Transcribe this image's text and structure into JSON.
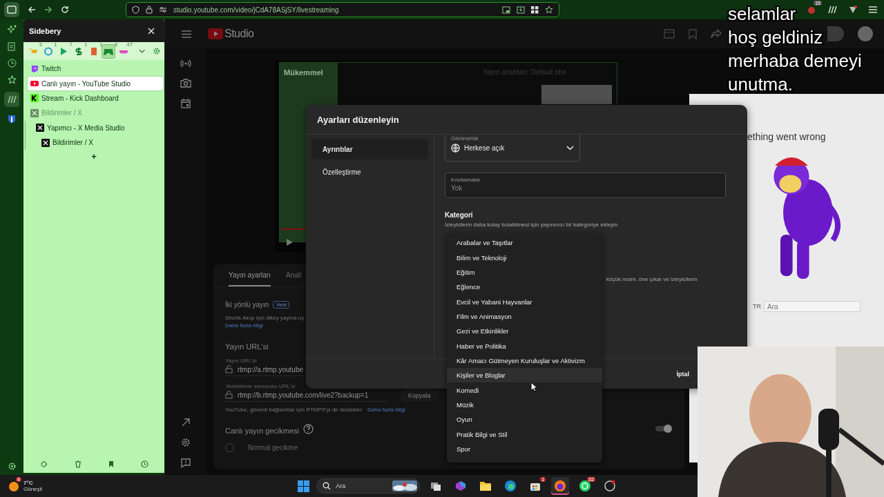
{
  "browser": {
    "url": "studio.youtube.com/video/jCdA78ASjSY/livestreaming",
    "extension_badge": "15"
  },
  "sidebery": {
    "title": "Sidebery",
    "panels": [
      {
        "kind": "cart",
        "count": "3",
        "color": "#e8b020",
        "selected": false
      },
      {
        "kind": "circle",
        "count": "1",
        "color": "#2a9ad8",
        "selected": false
      },
      {
        "kind": "play",
        "count": "7",
        "color": "#18a860",
        "selected": false
      },
      {
        "kind": "dollar",
        "count": "1",
        "color": "#1a7a30",
        "selected": false
      },
      {
        "kind": "book",
        "count": "1",
        "color": "#e06030",
        "selected": false
      },
      {
        "kind": "gamepad",
        "count": "6",
        "color": "#1a8a30",
        "selected": true
      },
      {
        "kind": "glasses",
        "count": "47",
        "color": "#e040c0",
        "selected": false
      }
    ],
    "tabs": [
      {
        "title": "Twitch",
        "kind": "twitch",
        "selected": false,
        "discarded": false
      },
      {
        "title": "Canlı yayın - YouTube Studio",
        "kind": "youtube",
        "selected": true,
        "discarded": false
      },
      {
        "title": "Stream - Kick Dashboard",
        "kind": "kick",
        "selected": false,
        "discarded": false
      },
      {
        "title": "Bildirimler / X",
        "kind": "x",
        "selected": false,
        "discarded": true,
        "children": [
          {
            "title": "Yapımcı - X Media Studio",
            "kind": "x",
            "selected": false,
            "discarded": false,
            "children": [
              {
                "title": "Bildirimler / X",
                "kind": "x",
                "selected": false,
                "discarded": false
              }
            ]
          }
        ]
      }
    ],
    "new_tab": "+"
  },
  "studio": {
    "logo_text": "Studio"
  },
  "preview": {
    "title": "Mükemmel",
    "stream_key": "Yayın anahtarı: Default stre"
  },
  "stream_settings": {
    "tabs": [
      {
        "label": "Yayın ayarları",
        "selected": true
      },
      {
        "label": "Anali",
        "selected": false
      }
    ],
    "two_way": "İki yönlü yayın",
    "badge": "Yeni",
    "two_way_text": "Shorts Akışı için dikey yayına uy",
    "more": "Daha fazla bilgi",
    "url_heading": "Yayın URL'si",
    "url_label": "Yayın URL'si",
    "url_value": "rtmp://a.rtmp.youtube",
    "backup_label": "Yedekleme sunucusu URL'si",
    "backup_value": "rtmp://b.rtmp.youtube.com/live2?backup=1",
    "copy": "Kopyala",
    "rtmps_note": "YouTube, güvenli bağlantılar için RTMPS'yi de destekler.",
    "rtmps_more": "Daha fazla bilgi",
    "latency_heading": "Canlı yayın gecikmesi",
    "latency_toggle_on": true,
    "latency_option": "Normal gecikme"
  },
  "dialog": {
    "title": "Ayarları düzenleyin",
    "nav": [
      {
        "label": "Ayrıntılar",
        "selected": true
      },
      {
        "label": "Özelleştirme",
        "selected": false
      }
    ],
    "visibility": {
      "label": "Görünürlük",
      "value": "Herkese açık"
    },
    "restrictions": {
      "label": "Kısıtlamalar",
      "value": "Yok"
    },
    "category": {
      "heading": "Kategori",
      "hint": "İzleyicilerin daha kolay bulabilmesi için yayınınızı bir kategoriye ekleyin"
    },
    "thumbnail_hint": "küçük resim, öne çıkar ve izleyicilerin",
    "cancel": "İptal",
    "menu": [
      {
        "label": "Arabalar ve Taşıtlar",
        "selected": false
      },
      {
        "label": "Bilim ve Teknoloji",
        "selected": false
      },
      {
        "label": "Eğitim",
        "selected": false
      },
      {
        "label": "Eğlence",
        "selected": false
      },
      {
        "label": "Evcil ve Yabani Hayvanlar",
        "selected": false
      },
      {
        "label": "Film ve Animasyon",
        "selected": false
      },
      {
        "label": "Gezi ve Etkinlikler",
        "selected": false
      },
      {
        "label": "Haber ve Politika",
        "selected": false
      },
      {
        "label": "Kâr Amacı Gütmeyen Kuruluşlar ve Aktivizm",
        "selected": false
      },
      {
        "label": "Kişiler ve Bloglar",
        "selected": true
      },
      {
        "label": "Komedi",
        "selected": false
      },
      {
        "label": "Müzik",
        "selected": false
      },
      {
        "label": "Oyun",
        "selected": false
      },
      {
        "label": "Pratik Bilgi ve Stil",
        "selected": false
      },
      {
        "label": "Spor",
        "selected": false
      }
    ]
  },
  "overlay_text": [
    "selamlar",
    "hoş geldiniz",
    "merhaba demeyi",
    "unutma."
  ],
  "error_page": {
    "message": "ething went wrong",
    "lang": "TR",
    "search_placeholder": "Ara"
  },
  "taskbar": {
    "temperature": "7°C",
    "weather": "Güneşli",
    "weather_badge": "4",
    "search_placeholder": "Ara",
    "apps": [
      {
        "kind": "taskview",
        "selected": false
      },
      {
        "kind": "m365",
        "selected": false
      },
      {
        "kind": "files",
        "selected": false
      },
      {
        "kind": "edge",
        "selected": false
      },
      {
        "kind": "store",
        "selected": false,
        "badge": "1"
      },
      {
        "kind": "firefox",
        "selected": true
      },
      {
        "kind": "whatsapp",
        "selected": false,
        "badge": "32"
      },
      {
        "kind": "other",
        "selected": false
      }
    ]
  }
}
